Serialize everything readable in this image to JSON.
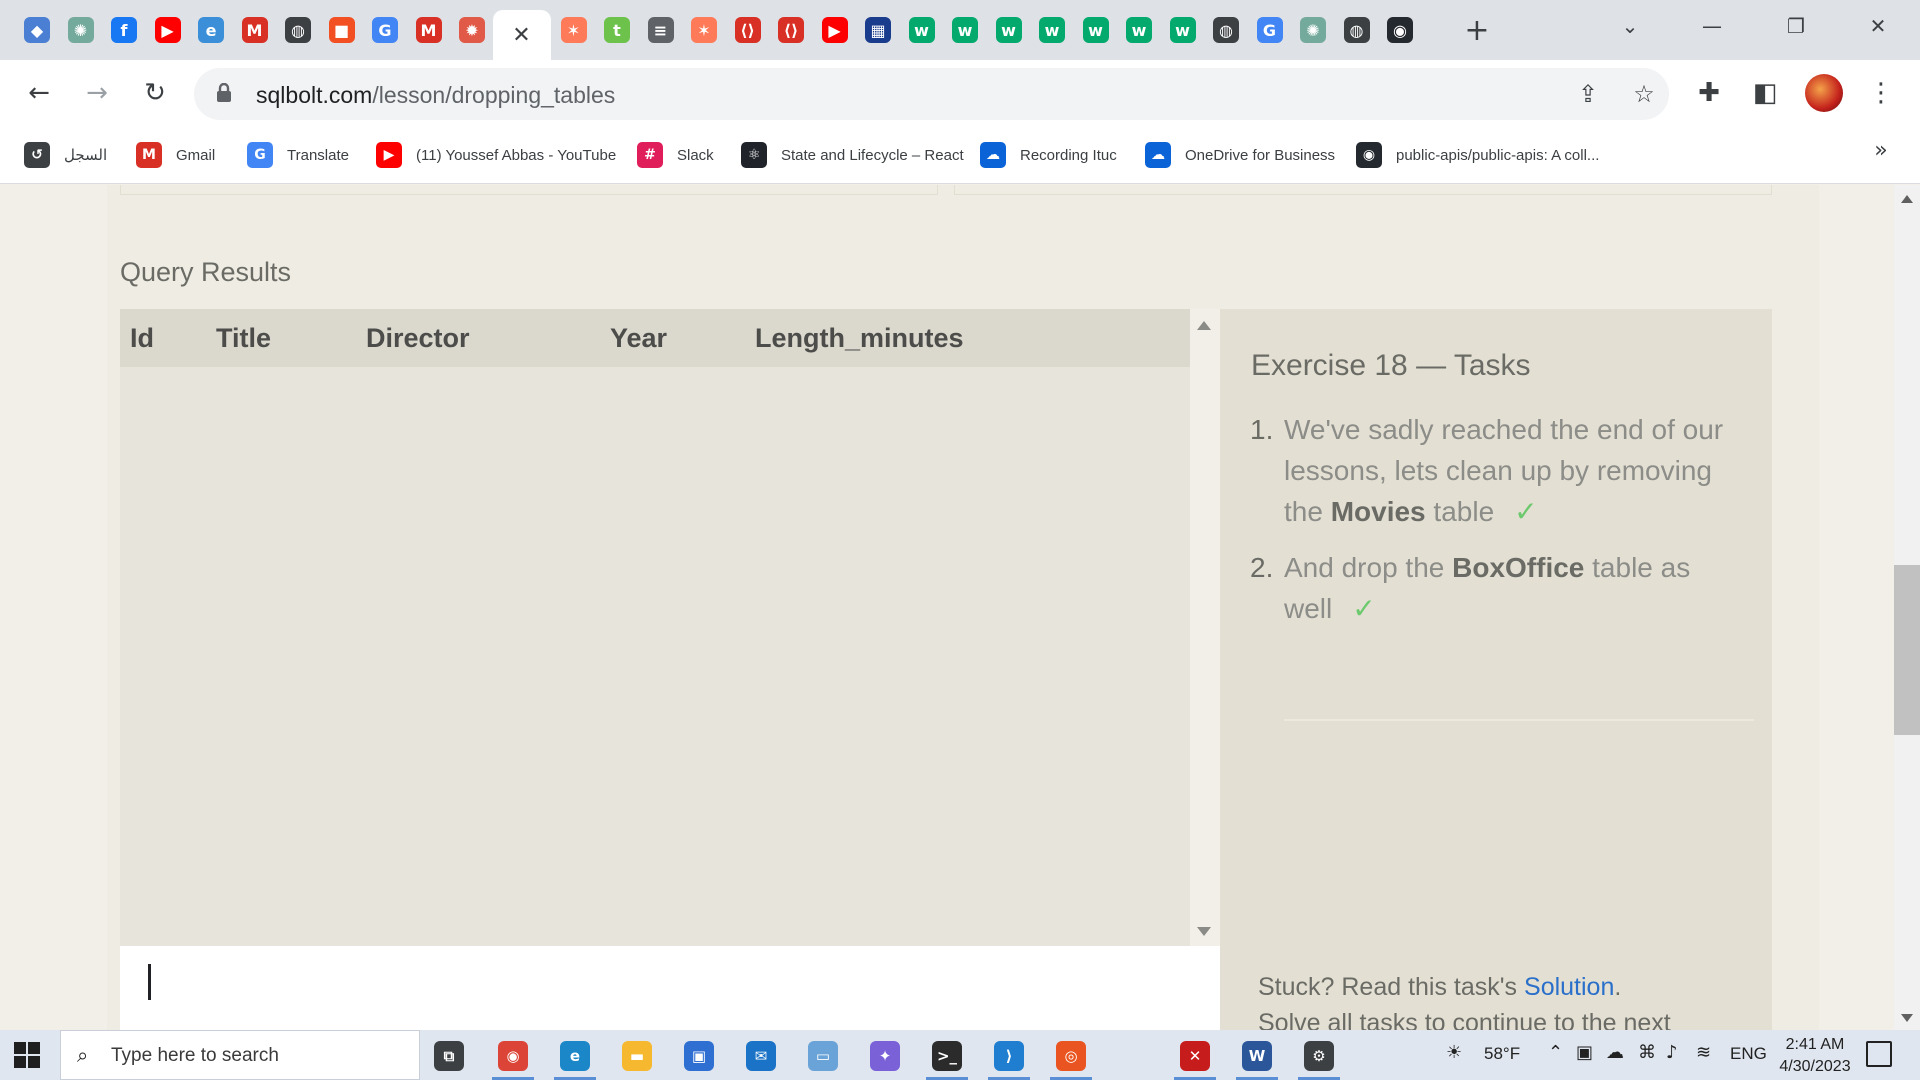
{
  "browser": {
    "url_host": "sqlbolt.com",
    "url_path": "/lesson/dropping_tables",
    "tabs": [
      {
        "icon": "bookmark-icon",
        "color": "#4a7fd4",
        "glyph": "◆"
      },
      {
        "icon": "chatgpt-icon",
        "color": "#74aa9c",
        "glyph": "✺"
      },
      {
        "icon": "facebook-icon",
        "color": "#1877f2",
        "glyph": "f"
      },
      {
        "icon": "youtube-icon",
        "color": "#ff0000",
        "glyph": "▶"
      },
      {
        "icon": "edge-icon",
        "color": "#3a8fd8",
        "glyph": "e"
      },
      {
        "icon": "gmail-icon",
        "color": "#d93025",
        "glyph": "M"
      },
      {
        "icon": "globe-icon",
        "color": "#3c4043",
        "glyph": "◍"
      },
      {
        "icon": "microsoft-icon",
        "color": "#f25022",
        "glyph": "■"
      },
      {
        "icon": "google-icon",
        "color": "#4285f4",
        "glyph": "G"
      },
      {
        "icon": "gmail-icon",
        "color": "#d93025",
        "glyph": "M"
      },
      {
        "icon": "settings-icon",
        "color": "#e05a47",
        "glyph": "✹"
      },
      {
        "icon": "hubspot-icon",
        "color": "#ff7a59",
        "glyph": "✶"
      },
      {
        "icon": "tumblr-icon",
        "color": "#6cc24a",
        "glyph": "t"
      },
      {
        "icon": "database-icon",
        "color": "#5f6368",
        "glyph": "≡"
      },
      {
        "icon": "hubspot-icon",
        "color": "#ff7a59",
        "glyph": "✶"
      },
      {
        "icon": "code-shield-icon",
        "color": "#d93025",
        "glyph": "⟨⟩"
      },
      {
        "icon": "code-shield-icon",
        "color": "#d93025",
        "glyph": "⟨⟩"
      },
      {
        "icon": "youtube-icon",
        "color": "#ff0000",
        "glyph": "▶"
      },
      {
        "icon": "grid-icon",
        "color": "#1a3c8c",
        "glyph": "▦"
      },
      {
        "icon": "w3schools-icon",
        "color": "#04aa6d",
        "glyph": "w"
      },
      {
        "icon": "w3schools-icon",
        "color": "#04aa6d",
        "glyph": "w"
      },
      {
        "icon": "w3schools-icon",
        "color": "#04aa6d",
        "glyph": "w"
      },
      {
        "icon": "w3schools-icon",
        "color": "#04aa6d",
        "glyph": "w"
      },
      {
        "icon": "w3schools-icon",
        "color": "#04aa6d",
        "glyph": "w"
      },
      {
        "icon": "w3schools-icon",
        "color": "#04aa6d",
        "glyph": "w"
      },
      {
        "icon": "w3schools-icon",
        "color": "#04aa6d",
        "glyph": "w"
      },
      {
        "icon": "globe-icon",
        "color": "#3c4043",
        "glyph": "◍"
      },
      {
        "icon": "google-icon",
        "color": "#4285f4",
        "glyph": "G"
      },
      {
        "icon": "chatgpt-icon",
        "color": "#74aa9c",
        "glyph": "✺"
      },
      {
        "icon": "globe-icon",
        "color": "#3c4043",
        "glyph": "◍"
      },
      {
        "icon": "github-icon",
        "color": "#24292f",
        "glyph": "◉"
      }
    ],
    "active_tab_index": 11,
    "bookmarks": [
      {
        "label": "السجل",
        "icon": "history-icon",
        "color": "#3c4043",
        "glyph": "↺"
      },
      {
        "label": "Gmail",
        "icon": "gmail-icon",
        "color": "#d93025",
        "glyph": "M"
      },
      {
        "label": "Translate",
        "icon": "translate-icon",
        "color": "#4285f4",
        "glyph": "G"
      },
      {
        "label": "(11) Youssef Abbas - YouTube",
        "icon": "youtube-icon",
        "color": "#ff0000",
        "glyph": "▶"
      },
      {
        "label": "Slack",
        "icon": "slack-icon",
        "color": "#e01e5a",
        "glyph": "#"
      },
      {
        "label": "State and Lifecycle – React",
        "icon": "react-icon",
        "color": "#20232a",
        "glyph": "⚛"
      },
      {
        "label": "Recording Ituc",
        "icon": "onedrive-icon",
        "color": "#0a64d8",
        "glyph": "☁"
      },
      {
        "label": "OneDrive for Business",
        "icon": "onedrive-icon",
        "color": "#0a64d8",
        "glyph": "☁"
      },
      {
        "label": "public-apis/public-apis: A coll...",
        "icon": "github-icon",
        "color": "#24292f",
        "glyph": "◉"
      }
    ]
  },
  "page": {
    "query_results_title": "Query Results",
    "table_headers": [
      "Id",
      "Title",
      "Director",
      "Year",
      "Length_minutes"
    ],
    "table_rows": [],
    "tasks_title": "Exercise 18 — Tasks",
    "tasks": [
      {
        "num": "1.",
        "before": "We've sadly reached the end of our lessons, lets clean up by removing the ",
        "bold": "Movies",
        "after": " table",
        "check": "✓"
      },
      {
        "num": "2.",
        "before": "And drop the ",
        "bold": "BoxOffice",
        "after": " table as well",
        "check": "✓"
      }
    ],
    "stuck_prefix": "Stuck? Read this task's ",
    "stuck_link": "Solution",
    "stuck_suffix": ".",
    "continue_text": "Solve all tasks to continue to the next"
  },
  "taskbar": {
    "search_placeholder": "Type here to search",
    "apps": [
      {
        "icon": "task-view-icon",
        "color": "#3c4043",
        "glyph": "⧉",
        "running": false
      },
      {
        "icon": "chrome-icon",
        "color": "#db4437",
        "glyph": "◉",
        "running": true
      },
      {
        "icon": "edge-icon",
        "color": "#1b86c8",
        "glyph": "e",
        "running": true
      },
      {
        "icon": "file-explorer-icon",
        "color": "#f5b82e",
        "glyph": "▬",
        "running": false
      },
      {
        "icon": "store-icon",
        "color": "#2f6fd1",
        "glyph": "▣",
        "running": false
      },
      {
        "icon": "mail-icon",
        "color": "#1a73c6",
        "glyph": "✉",
        "running": false
      },
      {
        "icon": "network-icon",
        "color": "#6aa3d8",
        "glyph": "▭",
        "running": false
      },
      {
        "icon": "copilot-icon",
        "color": "#7b61d8",
        "glyph": "✦",
        "running": false
      },
      {
        "icon": "terminal-icon",
        "color": "#2b2b2b",
        "glyph": ">_",
        "running": true
      },
      {
        "icon": "vscode-icon",
        "color": "#1f7ecf",
        "glyph": "⟩",
        "running": true
      },
      {
        "icon": "ubuntu-icon",
        "color": "#e95420",
        "glyph": "◎",
        "running": true
      },
      {
        "icon": "pdf-icon",
        "color": "#c71c1c",
        "glyph": "✕",
        "running": true
      },
      {
        "icon": "word-icon",
        "color": "#2b579a",
        "glyph": "W",
        "running": true
      },
      {
        "icon": "settings-icon",
        "color": "#3c4043",
        "glyph": "⚙",
        "running": true
      }
    ],
    "weather": "58°F",
    "language": "ENG",
    "time": "2:41 AM",
    "date": "4/30/2023"
  }
}
